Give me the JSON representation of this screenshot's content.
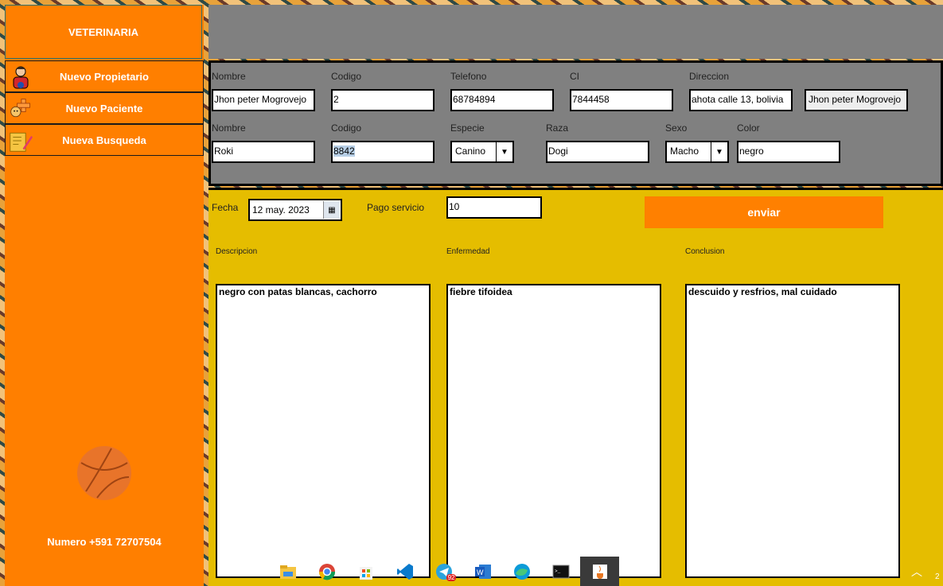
{
  "sidebar": {
    "title": "VETERINARIA",
    "items": [
      {
        "label": "Nuevo Propietario",
        "icon": "owner-icon"
      },
      {
        "label": "Nuevo Paciente",
        "icon": "pet-add-icon"
      },
      {
        "label": "Nueva Busqueda",
        "icon": "search-notes-icon"
      }
    ],
    "footer": "Numero +591 72707504"
  },
  "owner": {
    "labels": {
      "nombre": "Nombre",
      "codigo": "Codigo",
      "telefono": "Telefono",
      "ci": "CI",
      "direccion": "Direccion"
    },
    "values": {
      "nombre": "Jhon peter Mogrovejo",
      "codigo": "2",
      "telefono": "68784894",
      "ci": "7844458",
      "direccion": "ahota calle 13, bolivia"
    },
    "selected_owner": "Jhon peter Mogrovejo"
  },
  "pet": {
    "labels": {
      "nombre": "Nombre",
      "codigo": "Codigo",
      "especie": "Especie",
      "raza": "Raza",
      "sexo": "Sexo",
      "color": "Color"
    },
    "values": {
      "nombre": "Roki",
      "codigo": "8842",
      "especie": "Canino",
      "raza": "Dogi",
      "sexo": "Macho",
      "color": "negro"
    }
  },
  "service": {
    "fecha_label": "Fecha",
    "fecha_value": "12 may. 2023",
    "pago_label": "Pago servicio",
    "pago_value": "10",
    "enviar_label": "enviar",
    "descripcion_label": "Descripcion",
    "descripcion_value": "negro con patas blancas, cachorro",
    "enfermedad_label": "Enfermedad",
    "enfermedad_value": "fiebre tifoidea",
    "conclusion_label": "Conclusion",
    "conclusion_value": "descuido y resfrios, mal cuidado"
  },
  "taskbar": {
    "icons": [
      "file-explorer-icon",
      "chrome-icon",
      "store-icon",
      "vscode-icon",
      "telegram-icon",
      "word-icon",
      "edge-icon",
      "terminal-icon",
      "java-icon"
    ],
    "telegram_badge": "92",
    "corner_text": "2"
  },
  "colors": {
    "accent": "#ff7f00",
    "panel": "#808080",
    "bottom": "#e5bd00"
  }
}
